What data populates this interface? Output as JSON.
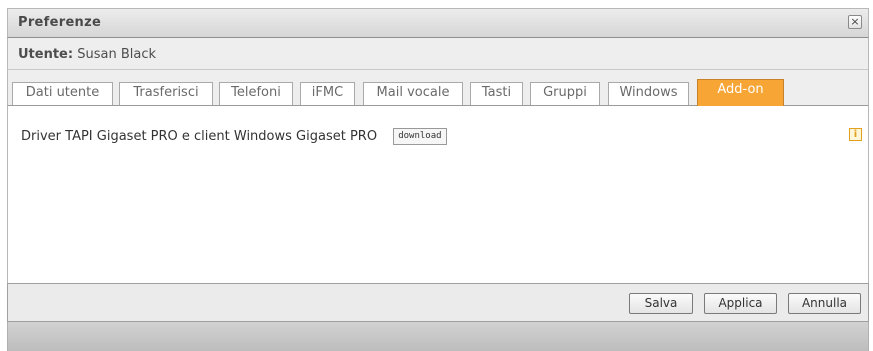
{
  "window": {
    "title": "Preferenze",
    "close_glyph": "×",
    "close_icon": "close-icon"
  },
  "user": {
    "label": "Utente:",
    "name": "Susan Black"
  },
  "tabs": [
    {
      "label": "Dati utente",
      "active": false
    },
    {
      "label": "Trasferisci",
      "active": false
    },
    {
      "label": "Telefoni",
      "active": false
    },
    {
      "label": "iFMC",
      "active": false
    },
    {
      "label": "Mail vocale",
      "active": false
    },
    {
      "label": "Tasti",
      "active": false
    },
    {
      "label": "Gruppi",
      "active": false
    },
    {
      "label": "Windows",
      "active": false
    },
    {
      "label": "Add-on",
      "active": true
    }
  ],
  "content": {
    "addon_text": "Driver TAPI Gigaset PRO e client Windows Gigaset PRO",
    "download_label": "download",
    "info_glyph": "i",
    "info_icon": "info-icon"
  },
  "footer": {
    "save_label": "Salva",
    "apply_label": "Applica",
    "cancel_label": "Annulla"
  },
  "colors": {
    "active_tab": "#f7a535",
    "info_accent": "#e0a020"
  }
}
